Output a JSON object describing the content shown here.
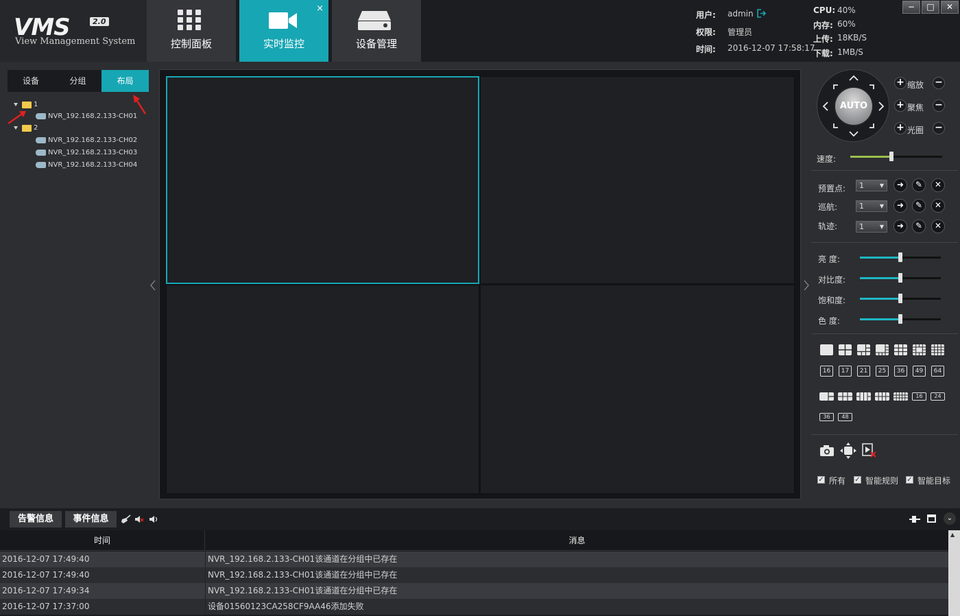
{
  "header": {
    "logo_text": "VMS",
    "logo_version": "2.0",
    "logo_subtitle": "View Management System",
    "tabs": [
      {
        "label": "控制面板",
        "icon": "grid-icon"
      },
      {
        "label": "实时监控",
        "icon": "video-camera-icon",
        "close": "×"
      },
      {
        "label": "设备管理",
        "icon": "device-drive-icon"
      }
    ],
    "user_label": "用户:",
    "user_value": "admin",
    "role_label": "权限:",
    "role_value": "管理员",
    "time_label": "时间:",
    "time_value": "2016-12-07 17:58:17",
    "cpu_label": "CPU:",
    "cpu_value": "40%",
    "mem_label": "内存:",
    "mem_value": "60%",
    "up_label": "上传:",
    "up_value": "18KB/S",
    "down_label": "下载:",
    "down_value": "1MB/S",
    "window_buttons": [
      "−",
      "□",
      "✕"
    ]
  },
  "left": {
    "tabs": [
      "设备",
      "分组",
      "布局"
    ],
    "tree": {
      "group1": "1",
      "group1_items": [
        "NVR_192.168.2.133-CH01"
      ],
      "group2": "2",
      "group2_items": [
        "NVR_192.168.2.133-CH02",
        "NVR_192.168.2.133-CH03",
        "NVR_192.168.2.133-CH04"
      ]
    }
  },
  "ptz": {
    "auto_label": "AUTO",
    "zoom_label": "缩放",
    "focus_label": "聚焦",
    "iris_label": "光圈",
    "speed_label": "速度:",
    "speed_value": 0.45,
    "preset_label": "预置点:",
    "cruise_label": "巡航:",
    "track_label": "轨迹:",
    "preset_value": "1",
    "cruise_value": "1",
    "track_value": "1"
  },
  "image": {
    "brightness_label": "亮  度:",
    "contrast_label": "对比度:",
    "saturation_label": "饱和度:",
    "hue_label": "色  度:",
    "brightness": 0.5,
    "contrast": 0.5,
    "saturation": 0.5,
    "hue": 0.5
  },
  "layouts": {
    "row2": [
      "16",
      "17",
      "21",
      "25",
      "36",
      "49",
      "64"
    ],
    "row3_nums": [
      "16",
      "24"
    ],
    "row4": [
      "36",
      "48"
    ]
  },
  "checks": {
    "all": "所有",
    "rules": "智能规则",
    "targets": "智能目标"
  },
  "bottom": {
    "tab_alarm": "告警信息",
    "tab_event": "事件信息",
    "col_time": "时间",
    "col_msg": "消息",
    "rows": [
      {
        "time": "2016-12-07 17:49:40",
        "msg": "NVR_192.168.2.133-CH01该通道在分组中已存在"
      },
      {
        "time": "2016-12-07 17:49:40",
        "msg": "NVR_192.168.2.133-CH01该通道在分组中已存在"
      },
      {
        "time": "2016-12-07 17:49:34",
        "msg": "NVR_192.168.2.133-CH01该通道在分组中已存在"
      },
      {
        "time": "2016-12-07 17:37:00",
        "msg": "设备01560123CA258CF9AA46添加失败"
      }
    ]
  },
  "colors": {
    "accent": "#17a6b3",
    "speed_fill": "#9bbf4c",
    "image_fill": "#1fb6c4"
  }
}
